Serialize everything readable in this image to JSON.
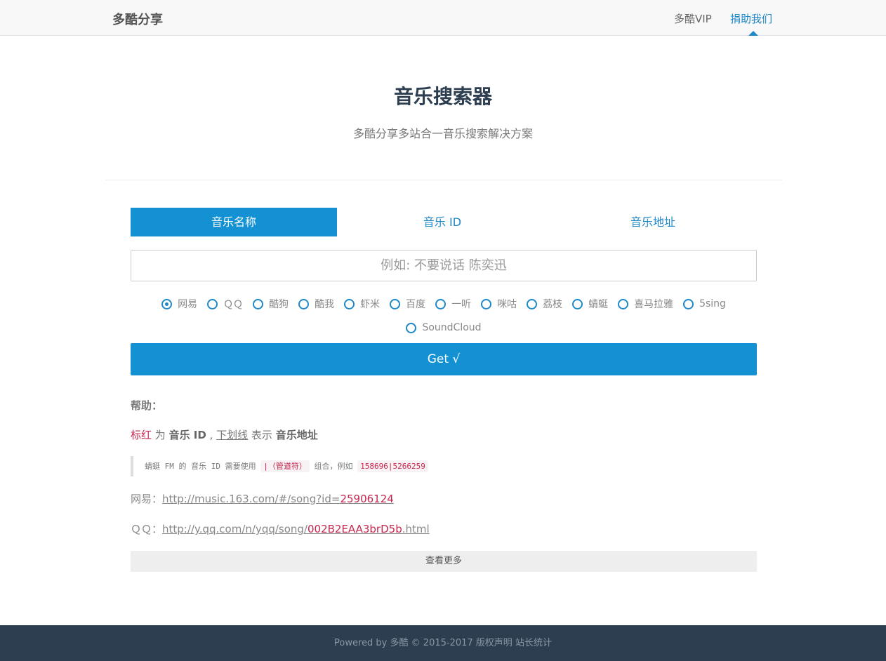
{
  "navbar": {
    "brand": "多酷分享",
    "links": [
      {
        "label": "多酷VIP"
      },
      {
        "label": "捐助我们"
      }
    ]
  },
  "hero": {
    "title": "音乐搜索器",
    "subtitle": "多酷分享多站合一音乐搜索解决方案"
  },
  "tabs": [
    {
      "label": "音乐名称",
      "active": true
    },
    {
      "label": "音乐 ID",
      "active": false
    },
    {
      "label": "音乐地址",
      "active": false
    }
  ],
  "search": {
    "placeholder": "例如: 不要说话 陈奕迅",
    "value": ""
  },
  "sources": [
    {
      "label": "网易",
      "checked": true
    },
    {
      "label": "ＱＱ",
      "checked": false
    },
    {
      "label": "酷狗",
      "checked": false
    },
    {
      "label": "酷我",
      "checked": false
    },
    {
      "label": "虾米",
      "checked": false
    },
    {
      "label": "百度",
      "checked": false
    },
    {
      "label": "一听",
      "checked": false
    },
    {
      "label": "咪咕",
      "checked": false
    },
    {
      "label": "荔枝",
      "checked": false
    },
    {
      "label": "蜻蜓",
      "checked": false
    },
    {
      "label": "喜马拉雅",
      "checked": false
    },
    {
      "label": "5sing",
      "checked": false
    },
    {
      "label": "SoundCloud",
      "checked": false
    }
  ],
  "get_button": {
    "label": "Get √"
  },
  "help": {
    "heading": "帮助：",
    "legend": {
      "red_text": "标红",
      "is": " 为 ",
      "music_id": "音乐 ID",
      "comma": " , ",
      "underline_text": "下划线",
      "means": " 表示 ",
      "music_url": "音乐地址"
    },
    "note": {
      "prefix": "蜻蜓 FM 的 音乐 ID 需要使用 ",
      "pipe_code": "|（管道符）",
      "middle": " 组合，例如 ",
      "example_code": "158696|5266259"
    },
    "examples": [
      {
        "label": "网易：",
        "url_prefix": "http://music.163.com/#/song?id=",
        "url_id": "25906124"
      },
      {
        "label": "ＱＱ：",
        "url_prefix": "http://y.qq.com/n/yqq/song/",
        "url_id": "002B2EAA3brD5b",
        "url_suffix": ".html"
      }
    ],
    "more_button": "查看更多"
  },
  "footer": {
    "powered": "Powered by ",
    "brand": "多酷",
    "copyright": " © 2015-2017 ",
    "copyright_link": "版权声明",
    "stats_link": "站长统计"
  },
  "colors": {
    "primary": "#1391d3",
    "highlight": "#c7254e",
    "footer_bg": "#2d3e50"
  }
}
